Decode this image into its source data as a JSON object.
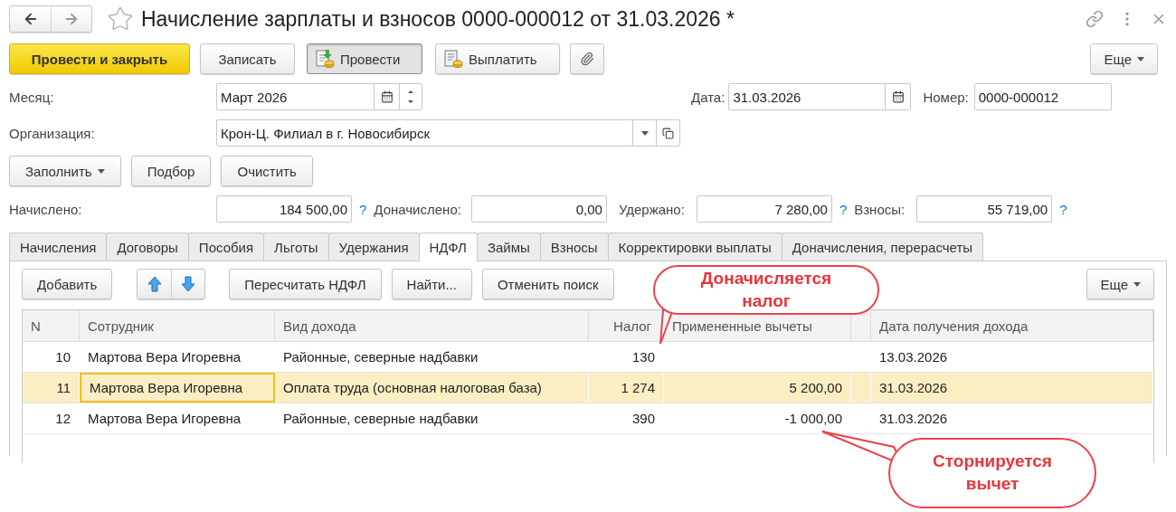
{
  "window": {
    "title": "Начисление зарплаты и взносов 0000-000012 от 31.03.2026 *",
    "favorite": false
  },
  "toolbar": {
    "buttons": [
      {
        "label": "Провести и закрыть",
        "kind": "primary",
        "pressed": false
      },
      {
        "label": "Записать",
        "kind": "plain",
        "pressed": false
      },
      {
        "label": "Провести",
        "kind": "post",
        "pressed": true
      },
      {
        "label": "Выплатить",
        "kind": "pay",
        "pressed": false
      },
      {
        "kind": "attach",
        "pressed": false
      }
    ],
    "more": "Еще"
  },
  "month": {
    "label": "Месяц:",
    "value": "Март 2026"
  },
  "date": {
    "label": "Дата:",
    "value": "31.03.2026"
  },
  "number": {
    "label": "Номер:",
    "value": "0000-000012"
  },
  "organization": {
    "label": "Организация:",
    "value": "Крон-Ц. Филиал в г. Новосибирск"
  },
  "fill_buttons": [
    {
      "label": "Заполнить",
      "dropdown": true
    },
    {
      "label": "Подбор",
      "dropdown": false
    },
    {
      "label": "Очистить",
      "dropdown": false
    }
  ],
  "totals": [
    {
      "label": "Начислено:",
      "value": "184 500,00",
      "help": "?"
    },
    {
      "label": "Доначислено:",
      "value": "0,00"
    },
    {
      "label": "Удержано:",
      "value": "7 280,00",
      "help": "?"
    },
    {
      "label": "Взносы:",
      "value": "55 719,00",
      "help": "?"
    }
  ],
  "tabs": [
    {
      "label": "Начисления",
      "selected": false
    },
    {
      "label": "Договоры",
      "selected": false
    },
    {
      "label": "Пособия",
      "selected": false
    },
    {
      "label": "Льготы",
      "selected": false
    },
    {
      "label": "Удержания",
      "selected": false
    },
    {
      "label": "НДФЛ",
      "selected": true
    },
    {
      "label": "Займы",
      "selected": false
    },
    {
      "label": "Взносы",
      "selected": false
    },
    {
      "label": "Корректировки выплаты",
      "selected": false
    },
    {
      "label": "Доначисления, перерасчеты",
      "selected": false
    }
  ],
  "panel_toolbar": {
    "buttons": [
      {
        "label": "Добавить",
        "kind": "text"
      },
      {
        "kind": "move"
      },
      {
        "label": "Пересчитать НДФЛ",
        "kind": "text"
      },
      {
        "label": "Найти...",
        "kind": "text"
      },
      {
        "label": "Отменить поиск",
        "kind": "text"
      }
    ],
    "more": "Еще"
  },
  "table": {
    "columns": [
      "N",
      "Сотрудник",
      "Вид дохода",
      "Налог",
      "Примененные вычеты",
      "",
      "Дата получения дохода"
    ],
    "rows": [
      {
        "cells": [
          "10",
          "Мартова Вера Игоревна",
          "Районные, северные надбавки",
          "130",
          "",
          "",
          "13.03.2026"
        ],
        "selected": false
      },
      {
        "cells": [
          "11",
          "Мартова Вера Игоревна",
          "Оплата труда (основная налоговая база)",
          "1 274",
          "5 200,00",
          "",
          "31.03.2026"
        ],
        "selected": true
      },
      {
        "cells": [
          "12",
          "Мартова Вера Игоревна",
          "Районные, северные надбавки",
          "390",
          "-1 000,00",
          "",
          "31.03.2026"
        ],
        "selected": false
      }
    ]
  },
  "callouts": [
    {
      "text": "Доначисляется налог"
    },
    {
      "text": "Сторнируется вычет"
    }
  ]
}
